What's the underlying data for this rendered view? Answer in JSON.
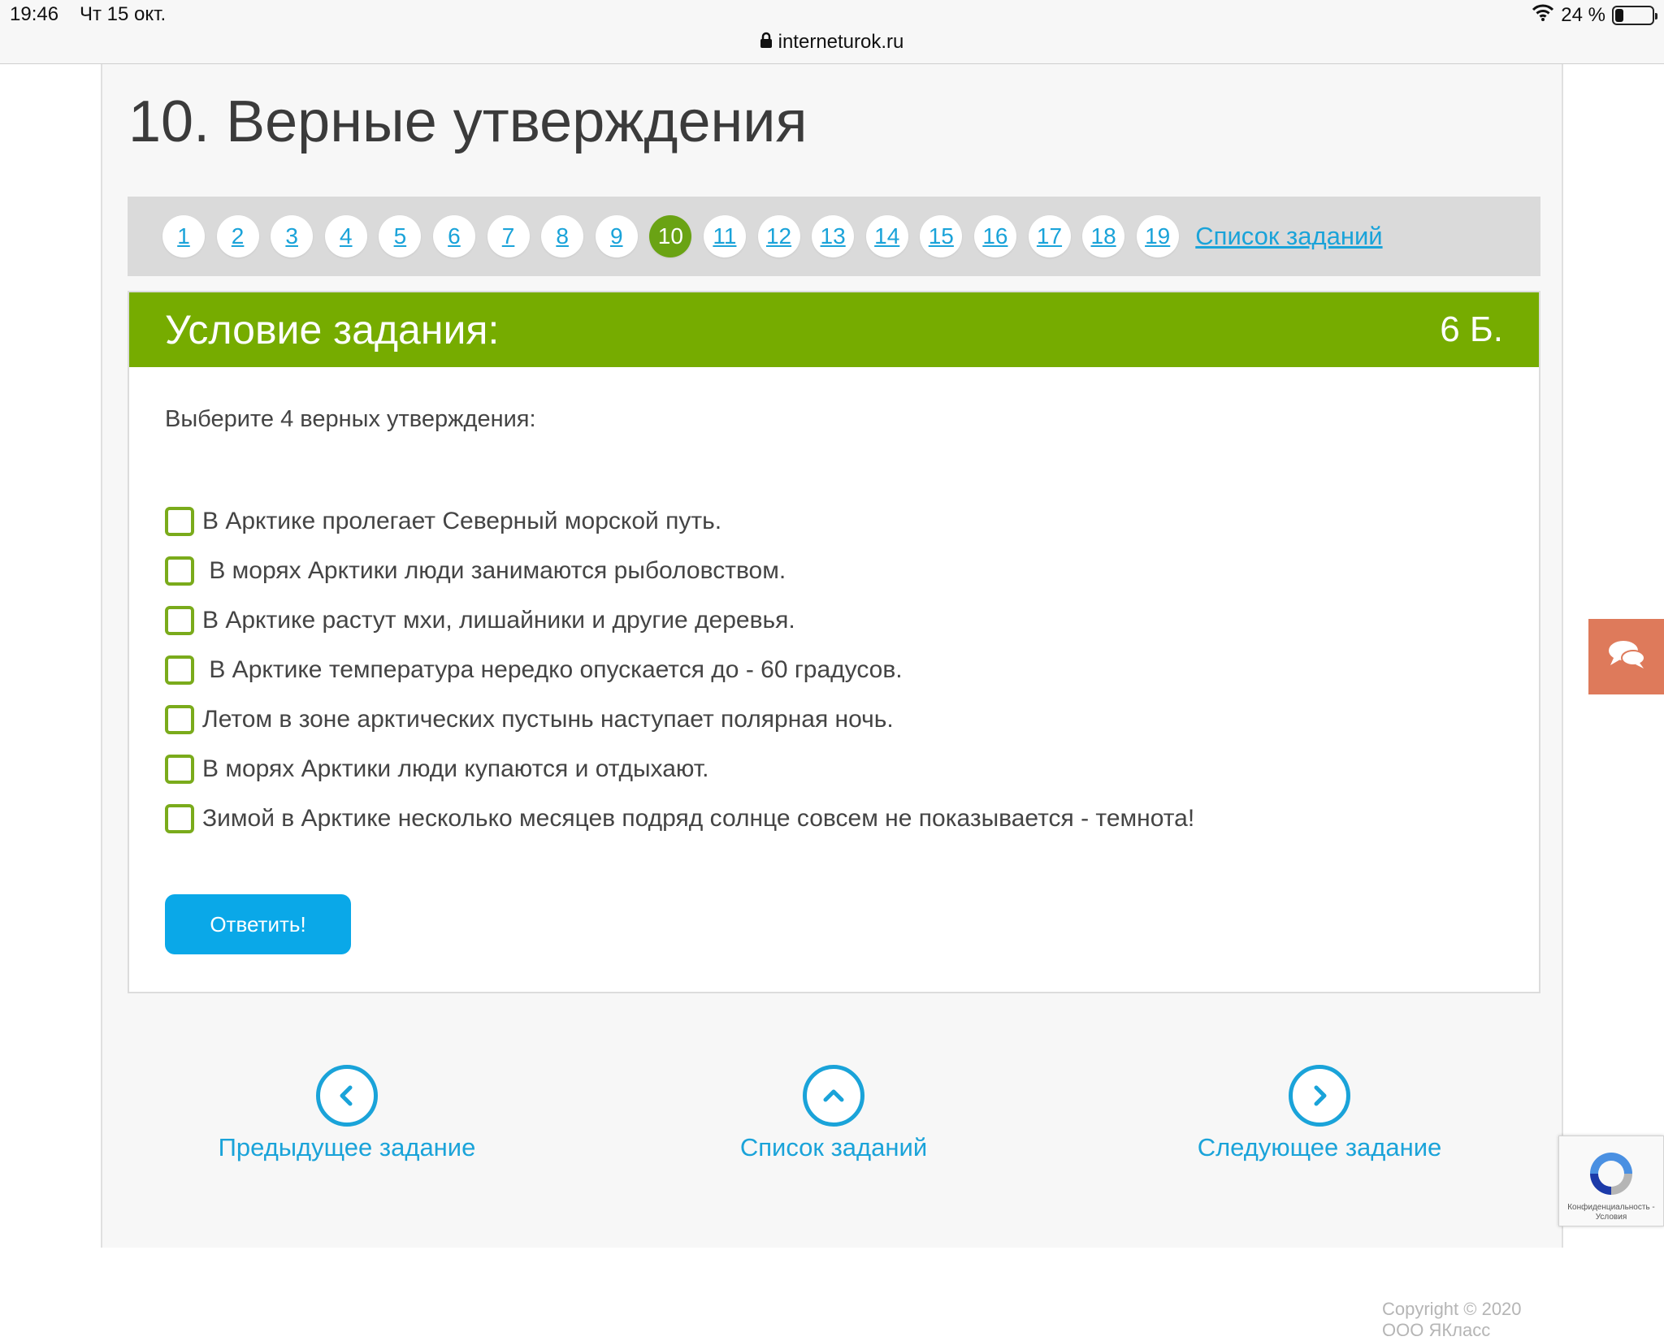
{
  "status_bar": {
    "time": "19:46",
    "date": "Чт 15 окт.",
    "battery": "24 %"
  },
  "browser": {
    "url": "interneturok.ru"
  },
  "page_title": "10. Верные утверждения",
  "task_nav": {
    "pages": [
      "1",
      "2",
      "3",
      "4",
      "5",
      "6",
      "7",
      "8",
      "9",
      "10",
      "11",
      "12",
      "13",
      "14",
      "15",
      "16",
      "17",
      "18",
      "19"
    ],
    "active": "10",
    "list_link": "Список заданий"
  },
  "panel": {
    "title": "Условие задания:",
    "points": "6 Б.",
    "instruction": "Выберите 4 верных утверждения:",
    "options": [
      "В Арктике пролегает Северный морской путь.",
      " В морях Арктики люди занимаются рыболовством.",
      "В Арктике растут мхи, лишайники и другие деревья.",
      " В Арктике температура нередко опускается до - 60 градусов.",
      "Летом в зоне арктических пустынь наступает полярная ночь.",
      "В морях Арктики люди купаются и отдыхают.",
      "Зимой в Арктике несколько месяцев подряд солнце совсем не показывается - темнота!"
    ],
    "answer_button": "Ответить!"
  },
  "bottom_nav": {
    "prev": "Предыдущее задание",
    "list": "Список заданий",
    "next": "Следующее задание"
  },
  "recaptcha": {
    "text": "Конфиденциальность - Условия"
  },
  "copyright": "Copyright © 2020 ООО ЯКласс",
  "colors": {
    "accent_green": "#76ac00",
    "link_blue": "#1aa3d9",
    "button_blue": "#0aa8e8",
    "chat_orange": "#de7a5b"
  },
  "icons": [
    "lock-icon",
    "wifi-icon",
    "battery-icon",
    "chevron-left-icon",
    "chevron-up-icon",
    "chevron-right-icon",
    "chat-icon",
    "recaptcha-icon"
  ]
}
